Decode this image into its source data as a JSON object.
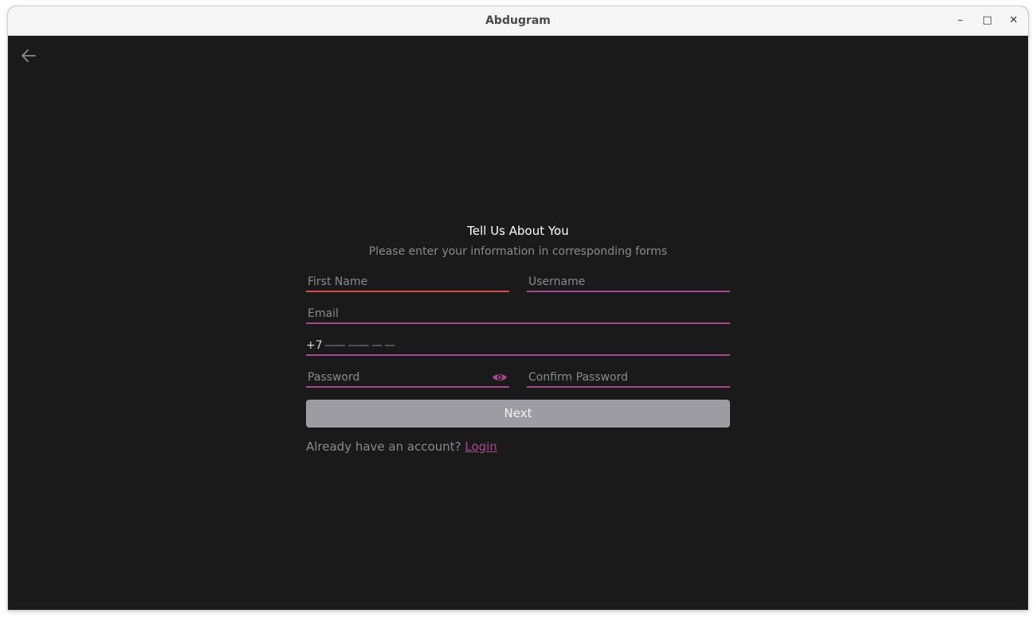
{
  "window": {
    "title": "Abdugram",
    "controls": {
      "minimize": "–",
      "maximize": "□",
      "close": "✕"
    }
  },
  "back_button": {
    "icon": "arrow-left-icon"
  },
  "form": {
    "heading": "Tell Us About You",
    "subheading": "Please enter your information in corresponding forms",
    "first_name": {
      "placeholder": "First Name",
      "value": ""
    },
    "username": {
      "placeholder": "Username",
      "value": ""
    },
    "email": {
      "placeholder": "Email",
      "value": ""
    },
    "phone": {
      "prefix": "+7",
      "mask": "—— —— — —"
    },
    "password": {
      "placeholder": "Password",
      "value": ""
    },
    "confirm_password": {
      "placeholder": "Confirm Password",
      "value": ""
    },
    "next_label": "Next",
    "already_text": "Already have an account?",
    "login_label": "Login"
  },
  "colors": {
    "background": "#1a1a1a",
    "accent": "#a8488f",
    "error": "#e04848",
    "button": "#9d9ca2"
  }
}
